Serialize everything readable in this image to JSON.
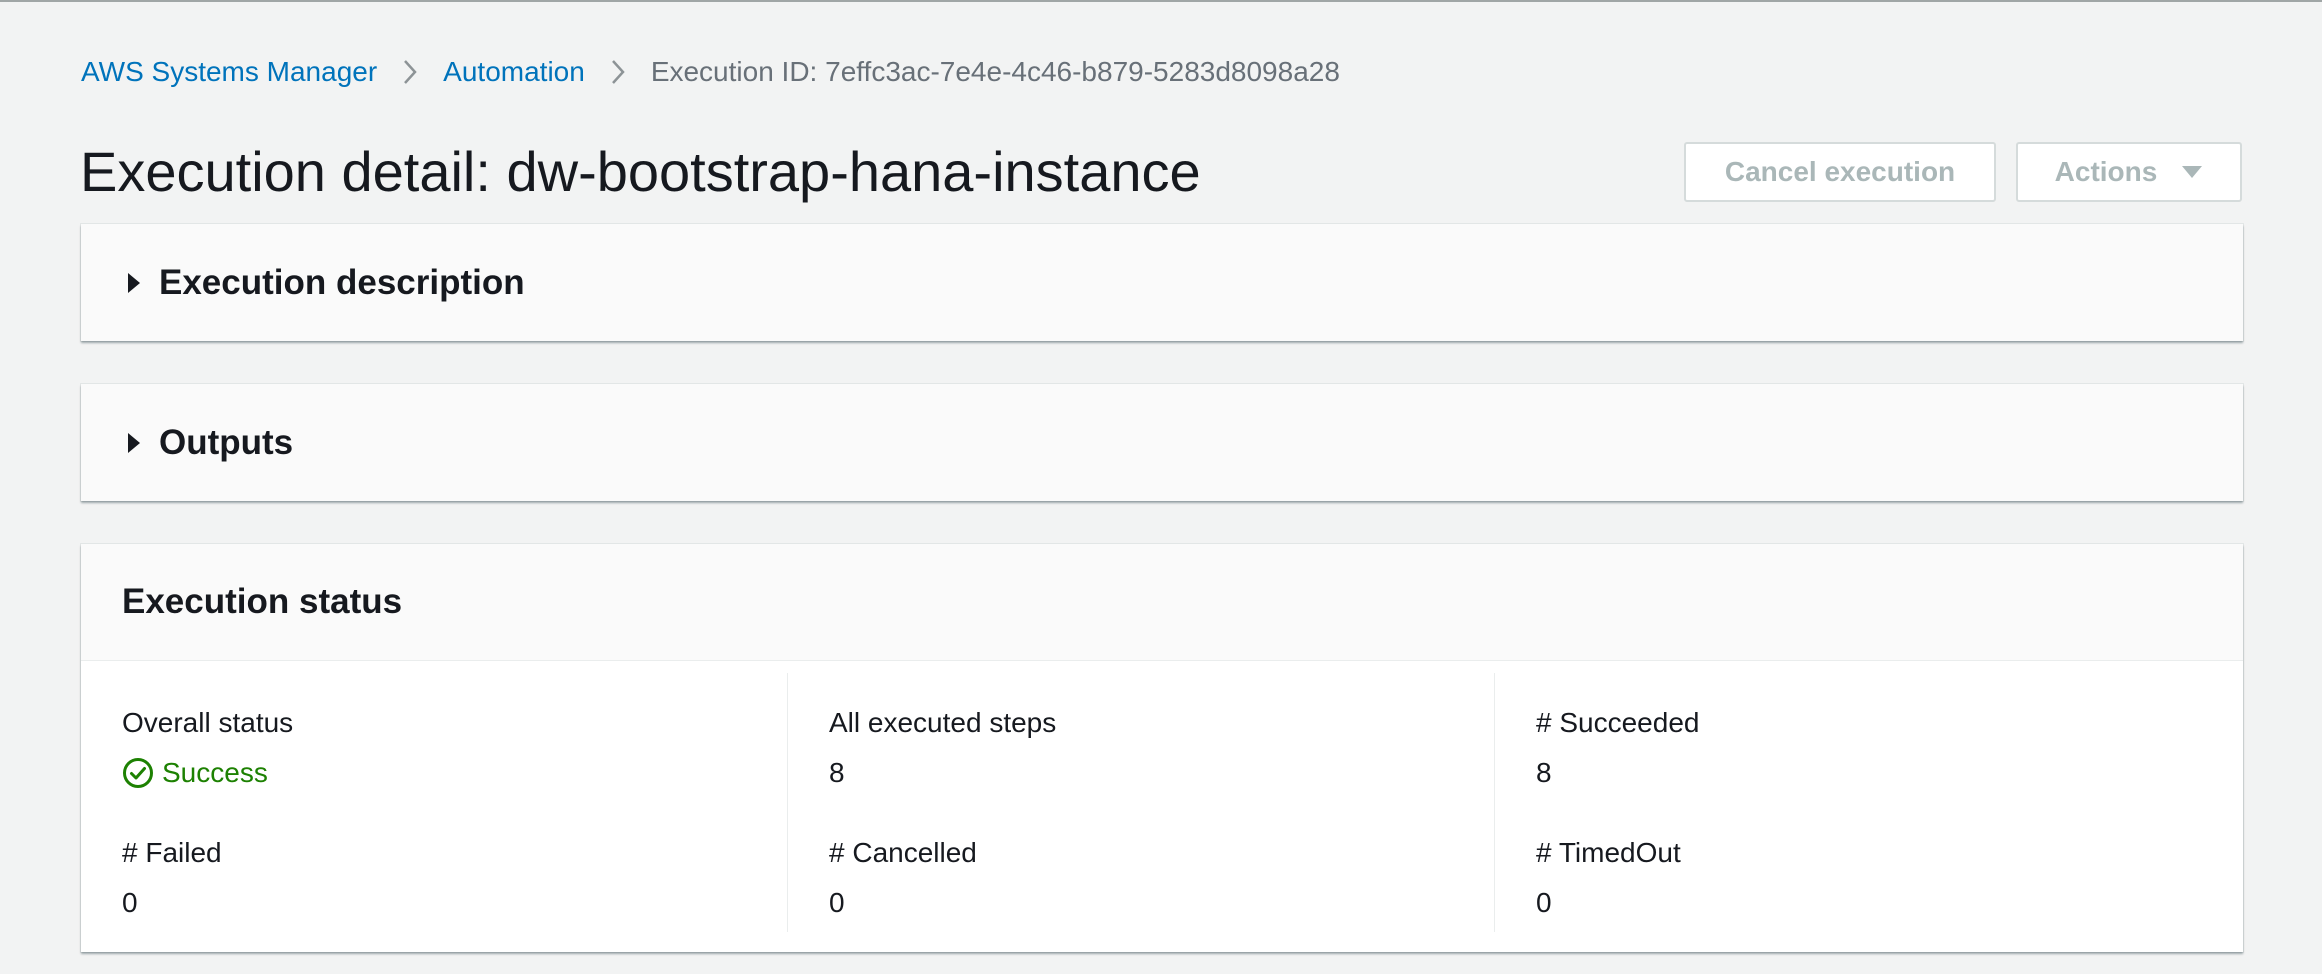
{
  "breadcrumb": {
    "items": [
      {
        "label": "AWS Systems Manager"
      },
      {
        "label": "Automation"
      }
    ],
    "current": "Execution ID: 7effc3ac-7e4e-4c46-b879-5283d8098a28"
  },
  "header": {
    "title": "Execution detail: dw-bootstrap-hana-instance",
    "cancel_label": "Cancel execution",
    "actions_label": "Actions"
  },
  "panels": {
    "description": {
      "heading": "Execution description",
      "expanded": false
    },
    "outputs": {
      "heading": "Outputs",
      "expanded": false
    }
  },
  "status": {
    "heading": "Execution status",
    "overall": {
      "label": "Overall status",
      "value": "Success"
    },
    "all_steps": {
      "label": "All executed steps",
      "value": "8"
    },
    "succeeded": {
      "label": "# Succeeded",
      "value": "8"
    },
    "failed": {
      "label": "# Failed",
      "value": "0"
    },
    "cancelled": {
      "label": "# Cancelled",
      "value": "0"
    },
    "timed_out": {
      "label": "# TimedOut",
      "value": "0"
    }
  },
  "icons": {
    "breadcrumb_separator": "chevron-right-icon",
    "actions_dropdown": "caret-down-icon",
    "panel_expand": "caret-right-icon",
    "success": "check-circle-icon"
  },
  "colors": {
    "link": "#0073bb",
    "success": "#1d8102",
    "disabled_text": "#aab7b8",
    "background": "#f2f3f3"
  }
}
